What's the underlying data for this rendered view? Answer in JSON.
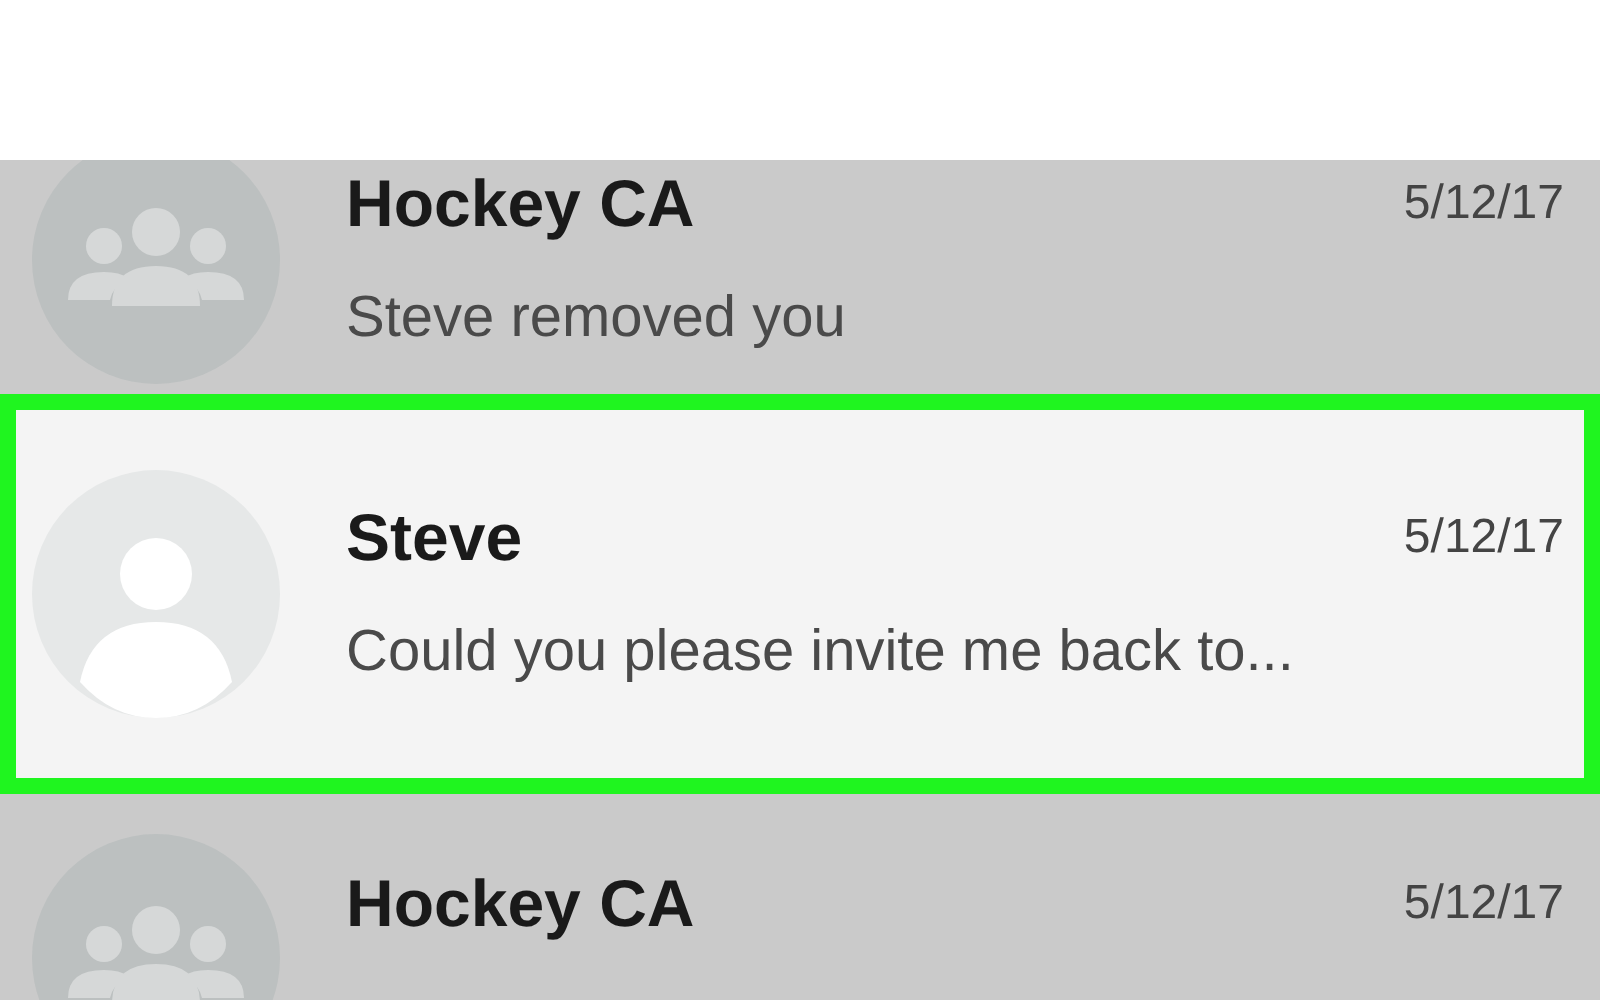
{
  "conversations": [
    {
      "kind": "group",
      "name": "Hockey CA",
      "date": "5/12/17",
      "message": "Steve removed you",
      "selected": false
    },
    {
      "kind": "person",
      "name": "Steve",
      "date": "5/12/17",
      "message": "Could you please invite me back to...",
      "selected": true
    },
    {
      "kind": "group",
      "name": "Hockey CA",
      "date": "5/12/17",
      "selected": false
    }
  ]
}
